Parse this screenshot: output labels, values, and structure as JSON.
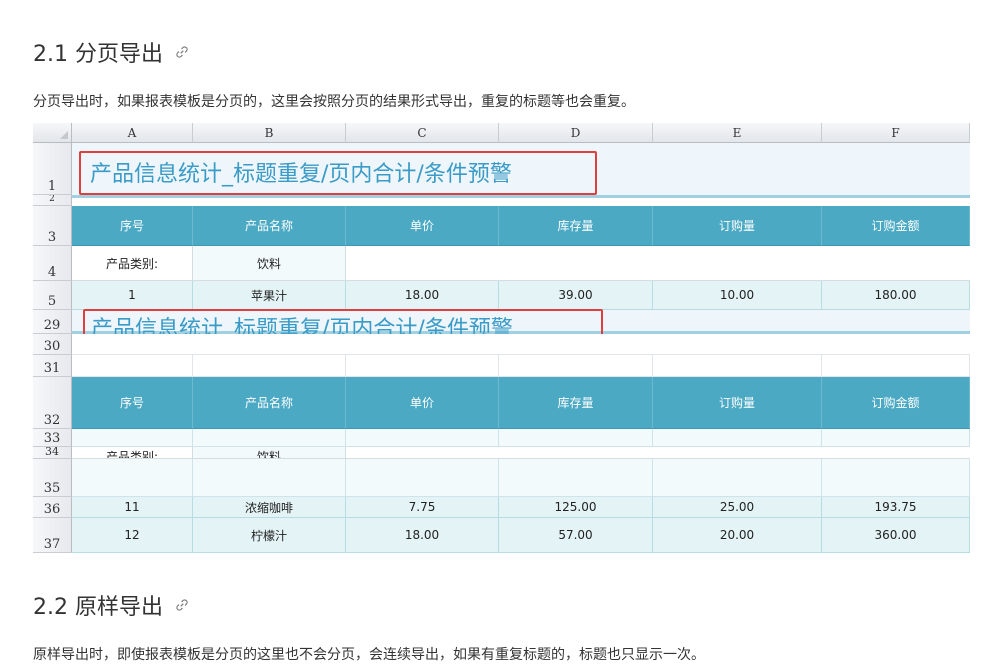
{
  "section1": {
    "heading": "2.1 分页导出",
    "paragraph": "分页导出时，如果报表模板是分页的，这里会按照分页的结果形式导出，重复的标题等也会重复。"
  },
  "section2": {
    "heading": "2.2 原样导出",
    "paragraph": "原样导出时，即使报表模板是分页的这里也不会分页，会连续导出，如果有重复标题的，标题也只显示一次。"
  },
  "sheet": {
    "columns": [
      "A",
      "B",
      "C",
      "D",
      "E",
      "F"
    ],
    "title": "产品信息统计_标题重复/页内合计/条件预警",
    "headers": [
      "序号",
      "产品名称",
      "单价",
      "库存量",
      "订购量",
      "订购金额"
    ],
    "category_label": "产品类别:",
    "category_value": "饮料",
    "row_numbers": {
      "r1": "1",
      "r2": "2",
      "r3": "3",
      "r4": "4",
      "r5": "5",
      "r29": "29",
      "r30": "30",
      "r31": "31",
      "r32": "32",
      "r33": "33",
      "r34": "34",
      "r35": "35",
      "r36": "36",
      "r37": "37"
    },
    "rows": [
      [
        "1",
        "苹果汁",
        "18.00",
        "39.00",
        "10.00",
        "180.00"
      ],
      [
        "11",
        "浓缩咖啡",
        "7.75",
        "125.00",
        "25.00",
        "193.75"
      ],
      [
        "12",
        "柠檬汁",
        "18.00",
        "57.00",
        "20.00",
        "360.00"
      ]
    ]
  },
  "colors": {
    "header_teal": "#4ba9c4",
    "title_blue": "#3a9bc7",
    "highlight_red": "#e0403d",
    "data_row": "#e4f3f5"
  }
}
